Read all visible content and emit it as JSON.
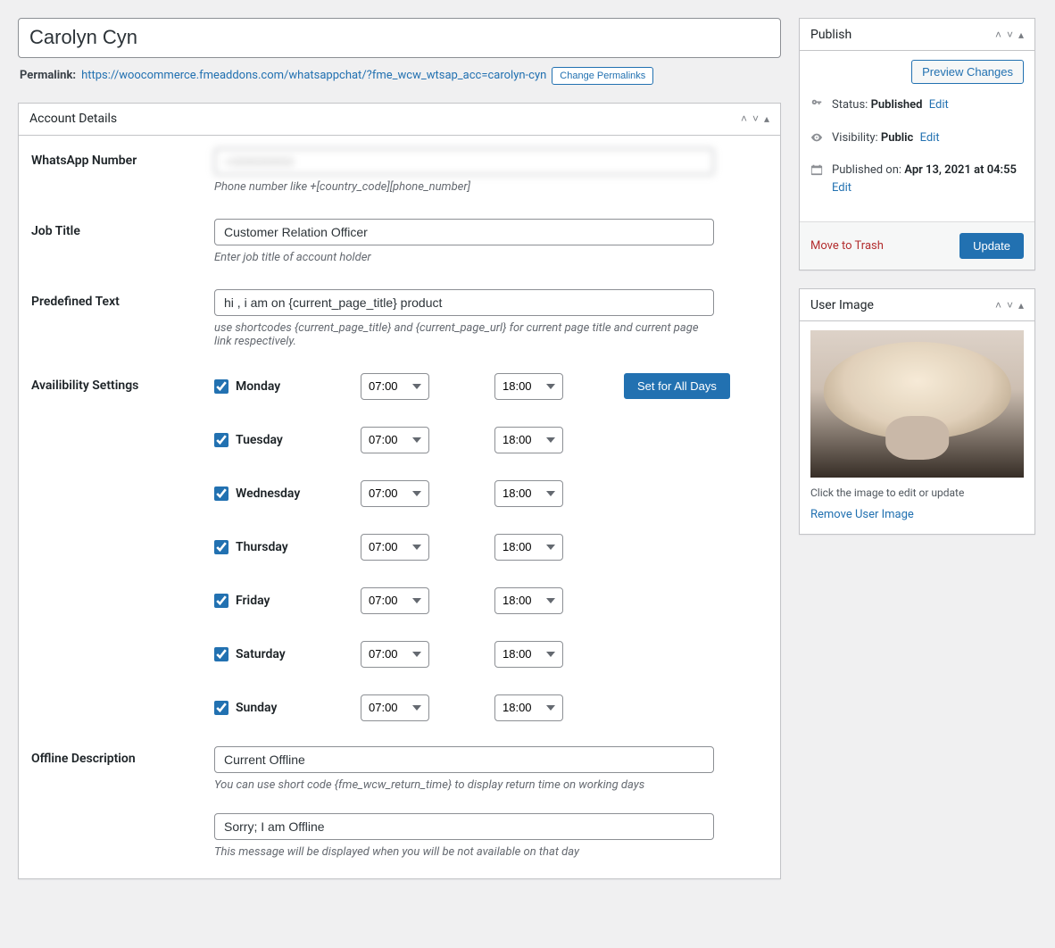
{
  "title": "Carolyn Cyn",
  "permalink": {
    "label": "Permalink:",
    "url": "https://woocommerce.fmeaddons.com/whatsappchat/?fme_wcw_wtsap_acc=carolyn-cyn",
    "change_btn": "Change Permalinks"
  },
  "account_details": {
    "heading": "Account Details",
    "whatsapp_label": "WhatsApp Number",
    "whatsapp_value": "+000000000",
    "whatsapp_help": "Phone number like +[country_code][phone_number]",
    "job_label": "Job Title",
    "job_value": "Customer Relation Officer",
    "job_help": "Enter job title of account holder",
    "predef_label": "Predefined Text",
    "predef_value": "hi , i am on {current_page_title} product",
    "predef_help": "use shortcodes {current_page_title} and {current_page_url} for current page title and current page link respectively.",
    "avail_label": "Availibility Settings",
    "set_all_btn": "Set for All Days",
    "days": [
      {
        "name": "Monday",
        "checked": true,
        "from": "07:00",
        "to": "18:00"
      },
      {
        "name": "Tuesday",
        "checked": true,
        "from": "07:00",
        "to": "18:00"
      },
      {
        "name": "Wednesday",
        "checked": true,
        "from": "07:00",
        "to": "18:00"
      },
      {
        "name": "Thursday",
        "checked": true,
        "from": "07:00",
        "to": "18:00"
      },
      {
        "name": "Friday",
        "checked": true,
        "from": "07:00",
        "to": "18:00"
      },
      {
        "name": "Saturday",
        "checked": true,
        "from": "07:00",
        "to": "18:00"
      },
      {
        "name": "Sunday",
        "checked": true,
        "from": "07:00",
        "to": "18:00"
      }
    ],
    "offline_label": "Offline Description",
    "offline_value1": "Current Offline",
    "offline_help1": "You can use short code {fme_wcw_return_time} to display return time on working days",
    "offline_value2": "Sorry; I am Offline",
    "offline_help2": "This message will be displayed when you will be not available on that day"
  },
  "publish": {
    "heading": "Publish",
    "preview_btn": "Preview Changes",
    "status_label": "Status:",
    "status_value": "Published",
    "visibility_label": "Visibility:",
    "visibility_value": "Public",
    "published_label": "Published on:",
    "published_value": "Apr 13, 2021 at 04:55",
    "edit_link": "Edit",
    "trash": "Move to Trash",
    "update_btn": "Update"
  },
  "user_image": {
    "heading": "User Image",
    "caption": "Click the image to edit or update",
    "remove": "Remove User Image"
  }
}
